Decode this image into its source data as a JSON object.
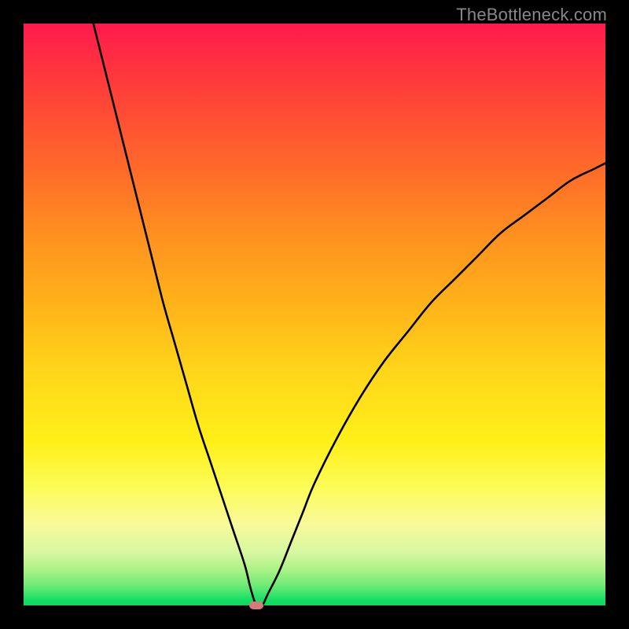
{
  "watermark": "TheBottleneck.com",
  "chart_data": {
    "type": "line",
    "title": "",
    "xlabel": "",
    "ylabel": "",
    "xlim": [
      0,
      100
    ],
    "ylim": [
      0,
      100
    ],
    "grid": false,
    "legend": false,
    "annotations": [
      {
        "kind": "marker",
        "x": 40,
        "y": 0,
        "color": "#d97a7a",
        "shape": "pill"
      }
    ],
    "background_gradient": {
      "direction": "vertical",
      "stops": [
        {
          "pos": 0,
          "color": "#ff1a4d"
        },
        {
          "pos": 50,
          "color": "#ffb21a"
        },
        {
          "pos": 80,
          "color": "#fcfc5a"
        },
        {
          "pos": 100,
          "color": "#0cd95f"
        }
      ]
    },
    "series": [
      {
        "name": "bottleneck-curve",
        "x": [
          12,
          14,
          16,
          18,
          20,
          22,
          24,
          26,
          28,
          30,
          32,
          34,
          36,
          38,
          39,
          40,
          41,
          42,
          44,
          46,
          48,
          50,
          54,
          58,
          62,
          66,
          70,
          74,
          78,
          82,
          86,
          90,
          94,
          98,
          100
        ],
        "y": [
          100,
          92,
          84,
          76,
          68,
          60,
          52,
          45,
          38,
          31,
          25,
          19,
          13,
          7,
          3,
          0,
          0,
          2,
          6,
          11,
          16,
          21,
          29,
          36,
          42,
          47,
          52,
          56,
          60,
          64,
          67,
          70,
          73,
          75,
          76
        ]
      }
    ]
  }
}
